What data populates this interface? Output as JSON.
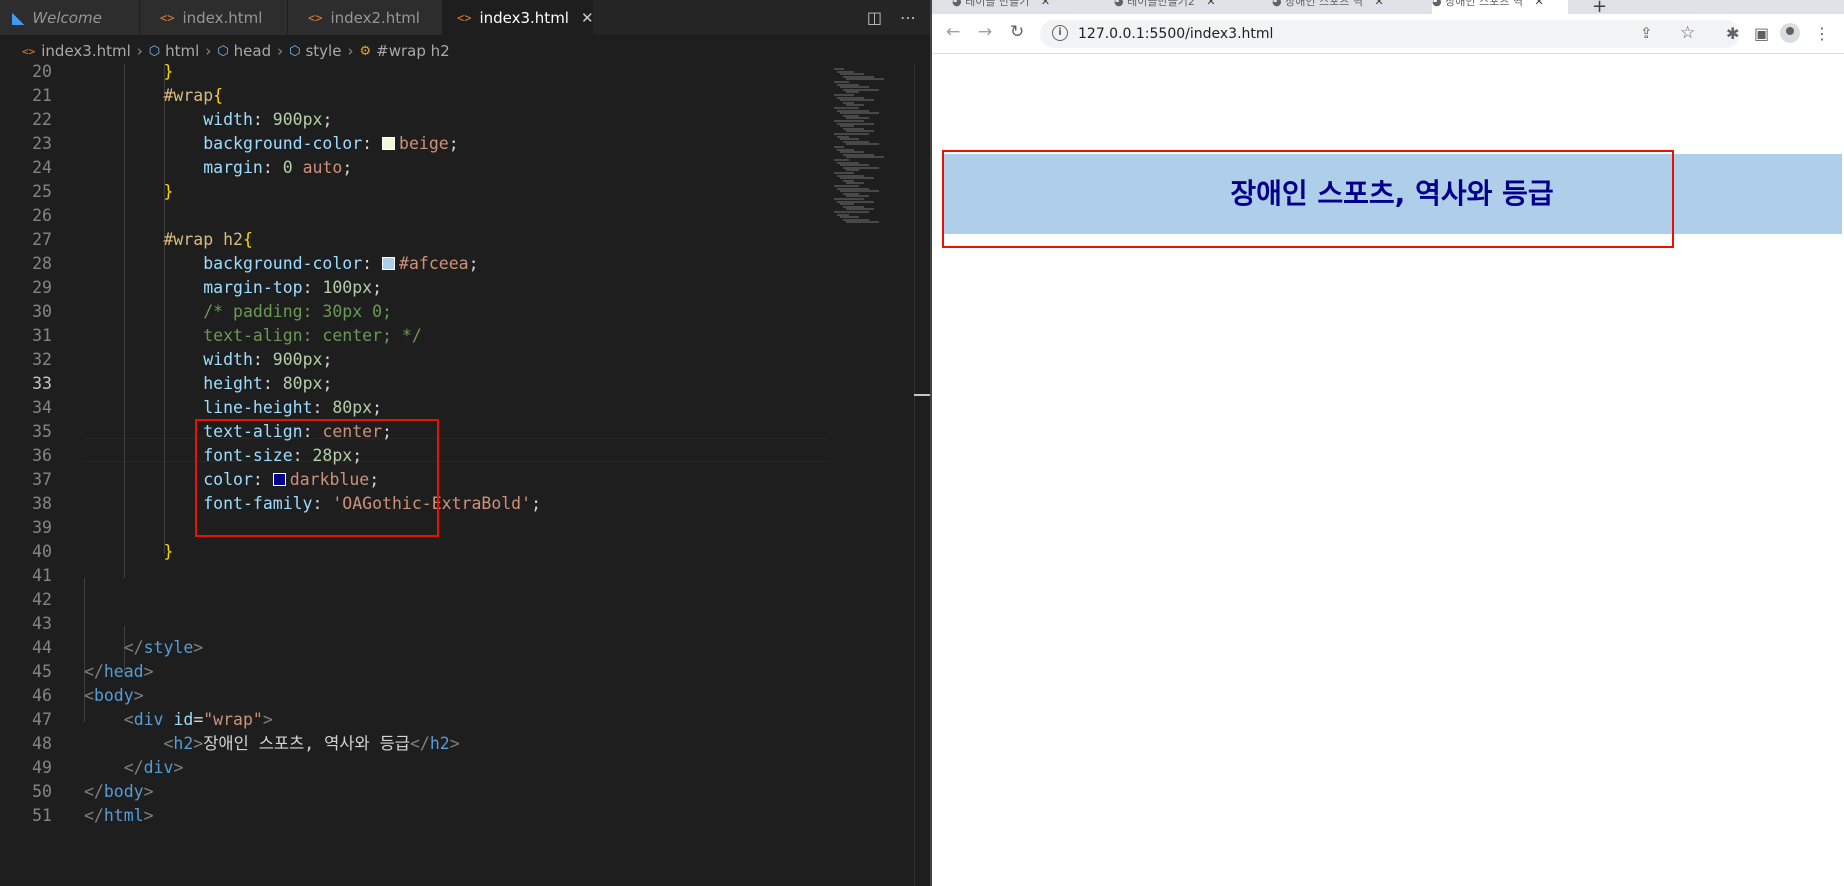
{
  "editor": {
    "tabs": [
      {
        "label": "Welcome",
        "icon": "vscode-icon",
        "active": false
      },
      {
        "label": "index.html",
        "icon": "html-icon",
        "active": false
      },
      {
        "label": "index2.html",
        "icon": "html-icon",
        "active": false
      },
      {
        "label": "index3.html",
        "icon": "html-icon",
        "active": true
      }
    ],
    "breadcrumb": [
      "index3.html",
      "html",
      "head",
      "style",
      "#wrap h2"
    ],
    "current_line": 33,
    "lines": [
      {
        "n": 20,
        "tokens": [
          {
            "t": "        "
          },
          {
            "t": "}",
            "c": "brace"
          }
        ]
      },
      {
        "n": 21,
        "tokens": [
          {
            "t": "        "
          },
          {
            "t": "#wrap",
            "c": "sel"
          },
          {
            "t": "{",
            "c": "brace"
          }
        ]
      },
      {
        "n": 22,
        "tokens": [
          {
            "t": "            "
          },
          {
            "t": "width",
            "c": "prop"
          },
          {
            "t": ": "
          },
          {
            "t": "900px",
            "c": "num"
          },
          {
            "t": ";"
          }
        ]
      },
      {
        "n": 23,
        "tokens": [
          {
            "t": "            "
          },
          {
            "t": "background-color",
            "c": "prop"
          },
          {
            "t": ": "
          },
          {
            "swatch": "#f5f5dc"
          },
          {
            "t": "beige",
            "c": "val"
          },
          {
            "t": ";"
          }
        ]
      },
      {
        "n": 24,
        "tokens": [
          {
            "t": "            "
          },
          {
            "t": "margin",
            "c": "prop"
          },
          {
            "t": ": "
          },
          {
            "t": "0",
            "c": "num"
          },
          {
            "t": " "
          },
          {
            "t": "auto",
            "c": "val"
          },
          {
            "t": ";"
          }
        ]
      },
      {
        "n": 25,
        "tokens": [
          {
            "t": "        "
          },
          {
            "t": "}",
            "c": "brace"
          }
        ]
      },
      {
        "n": 26,
        "tokens": []
      },
      {
        "n": 27,
        "tokens": [
          {
            "t": "        "
          },
          {
            "t": "#wrap h2",
            "c": "sel"
          },
          {
            "t": "{",
            "c": "brace"
          }
        ]
      },
      {
        "n": 28,
        "tokens": [
          {
            "t": "            "
          },
          {
            "t": "background-color",
            "c": "prop"
          },
          {
            "t": ": "
          },
          {
            "swatch": "#afceea"
          },
          {
            "t": "#afceea",
            "c": "val"
          },
          {
            "t": ";"
          }
        ]
      },
      {
        "n": 29,
        "tokens": [
          {
            "t": "            "
          },
          {
            "t": "margin-top",
            "c": "prop"
          },
          {
            "t": ": "
          },
          {
            "t": "100px",
            "c": "num"
          },
          {
            "t": ";"
          }
        ]
      },
      {
        "n": 30,
        "tokens": [
          {
            "t": "            "
          },
          {
            "t": "/* padding: 30px 0;",
            "c": "com"
          }
        ]
      },
      {
        "n": 31,
        "tokens": [
          {
            "t": "            "
          },
          {
            "t": "text-align: center; */",
            "c": "com"
          }
        ]
      },
      {
        "n": 32,
        "tokens": [
          {
            "t": "            "
          },
          {
            "t": "width",
            "c": "prop"
          },
          {
            "t": ": "
          },
          {
            "t": "900px",
            "c": "num"
          },
          {
            "t": ";"
          }
        ]
      },
      {
        "n": 33,
        "tokens": [
          {
            "t": "            "
          },
          {
            "t": "height",
            "c": "prop"
          },
          {
            "t": ": "
          },
          {
            "t": "80px",
            "c": "num"
          },
          {
            "t": ";"
          }
        ]
      },
      {
        "n": 34,
        "tokens": [
          {
            "t": "            "
          },
          {
            "t": "line-height",
            "c": "prop"
          },
          {
            "t": ": "
          },
          {
            "t": "80px",
            "c": "num"
          },
          {
            "t": ";"
          }
        ]
      },
      {
        "n": 35,
        "tokens": [
          {
            "t": "            "
          },
          {
            "t": "text-align",
            "c": "prop"
          },
          {
            "t": ": "
          },
          {
            "t": "center",
            "c": "val"
          },
          {
            "t": ";"
          }
        ]
      },
      {
        "n": 36,
        "tokens": [
          {
            "t": "            "
          },
          {
            "t": "font-size",
            "c": "prop"
          },
          {
            "t": ": "
          },
          {
            "t": "28px",
            "c": "num"
          },
          {
            "t": ";"
          }
        ]
      },
      {
        "n": 37,
        "tokens": [
          {
            "t": "            "
          },
          {
            "t": "color",
            "c": "prop"
          },
          {
            "t": ": "
          },
          {
            "swatch": "#00008b"
          },
          {
            "t": "darkblue",
            "c": "val"
          },
          {
            "t": ";"
          }
        ]
      },
      {
        "n": 38,
        "tokens": [
          {
            "t": "            "
          },
          {
            "t": "font-family",
            "c": "prop"
          },
          {
            "t": ": "
          },
          {
            "t": "'OAGothic-ExtraBold'",
            "c": "str"
          },
          {
            "t": ";"
          }
        ]
      },
      {
        "n": 39,
        "tokens": []
      },
      {
        "n": 40,
        "tokens": [
          {
            "t": "        "
          },
          {
            "t": "}",
            "c": "brace"
          }
        ]
      },
      {
        "n": 41,
        "tokens": []
      },
      {
        "n": 42,
        "tokens": []
      },
      {
        "n": 43,
        "tokens": []
      },
      {
        "n": 44,
        "tokens": [
          {
            "t": "    "
          },
          {
            "t": "</",
            "c": "brk"
          },
          {
            "t": "style",
            "c": "tag"
          },
          {
            "t": ">",
            "c": "brk"
          }
        ]
      },
      {
        "n": 45,
        "tokens": [
          {
            "t": "</",
            "c": "brk"
          },
          {
            "t": "head",
            "c": "tag"
          },
          {
            "t": ">",
            "c": "brk"
          }
        ]
      },
      {
        "n": 46,
        "tokens": [
          {
            "t": "<",
            "c": "brk"
          },
          {
            "t": "body",
            "c": "tag"
          },
          {
            "t": ">",
            "c": "brk"
          }
        ]
      },
      {
        "n": 47,
        "tokens": [
          {
            "t": "    "
          },
          {
            "t": "<",
            "c": "brk"
          },
          {
            "t": "div",
            "c": "tag"
          },
          {
            "t": " "
          },
          {
            "t": "id",
            "c": "attr"
          },
          {
            "t": "="
          },
          {
            "t": "\"wrap\"",
            "c": "str"
          },
          {
            "t": ">",
            "c": "brk"
          }
        ]
      },
      {
        "n": 48,
        "tokens": [
          {
            "t": "        "
          },
          {
            "t": "<",
            "c": "brk"
          },
          {
            "t": "h2",
            "c": "tag"
          },
          {
            "t": ">",
            "c": "brk"
          },
          {
            "t": "장애인 스포츠, 역사와 등급",
            "c": "plain"
          },
          {
            "t": "</",
            "c": "brk"
          },
          {
            "t": "h2",
            "c": "tag"
          },
          {
            "t": ">",
            "c": "brk"
          }
        ]
      },
      {
        "n": 49,
        "tokens": [
          {
            "t": "    "
          },
          {
            "t": "</",
            "c": "brk"
          },
          {
            "t": "div",
            "c": "tag"
          },
          {
            "t": ">",
            "c": "brk"
          }
        ]
      },
      {
        "n": 50,
        "tokens": [
          {
            "t": "</",
            "c": "brk"
          },
          {
            "t": "body",
            "c": "tag"
          },
          {
            "t": ">",
            "c": "brk"
          }
        ]
      },
      {
        "n": 51,
        "tokens": [
          {
            "t": "</",
            "c": "brk"
          },
          {
            "t": "html",
            "c": "tag"
          },
          {
            "t": ">",
            "c": "brk"
          }
        ]
      }
    ]
  },
  "browser": {
    "tabs": [
      {
        "label": "테이블 만들기",
        "active": false
      },
      {
        "label": "테이블만들기2",
        "active": false
      },
      {
        "label": "장애인 스포츠 역",
        "active": false
      },
      {
        "label": "장애인 스포츠 역",
        "active": true
      }
    ],
    "url": "127.0.0.1:5500/index3.html",
    "page": {
      "h2": "장애인 스포츠, 역사와 등급",
      "h2_bg": "#afceea",
      "h2_color": "#00008b",
      "wrap_bg": "#f5f5dc"
    }
  },
  "annotation_color": "#e51400"
}
